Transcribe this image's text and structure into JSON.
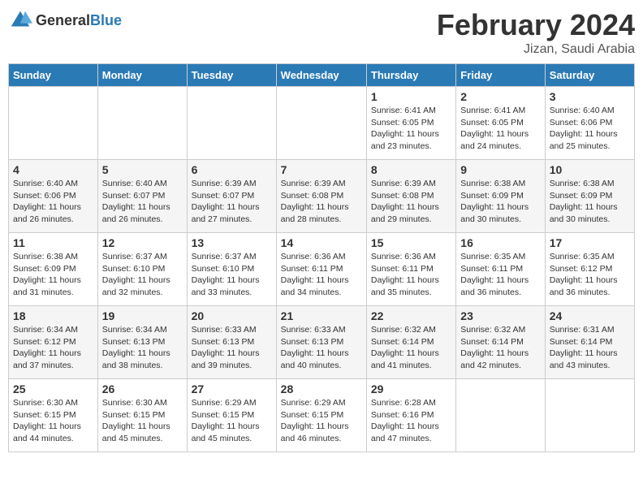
{
  "header": {
    "logo_general": "General",
    "logo_blue": "Blue",
    "month_title": "February 2024",
    "location": "Jizan, Saudi Arabia"
  },
  "weekdays": [
    "Sunday",
    "Monday",
    "Tuesday",
    "Wednesday",
    "Thursday",
    "Friday",
    "Saturday"
  ],
  "weeks": [
    [
      {
        "day": "",
        "info": ""
      },
      {
        "day": "",
        "info": ""
      },
      {
        "day": "",
        "info": ""
      },
      {
        "day": "",
        "info": ""
      },
      {
        "day": "1",
        "info": "Sunrise: 6:41 AM\nSunset: 6:05 PM\nDaylight: 11 hours\nand 23 minutes."
      },
      {
        "day": "2",
        "info": "Sunrise: 6:41 AM\nSunset: 6:05 PM\nDaylight: 11 hours\nand 24 minutes."
      },
      {
        "day": "3",
        "info": "Sunrise: 6:40 AM\nSunset: 6:06 PM\nDaylight: 11 hours\nand 25 minutes."
      }
    ],
    [
      {
        "day": "4",
        "info": "Sunrise: 6:40 AM\nSunset: 6:06 PM\nDaylight: 11 hours\nand 26 minutes."
      },
      {
        "day": "5",
        "info": "Sunrise: 6:40 AM\nSunset: 6:07 PM\nDaylight: 11 hours\nand 26 minutes."
      },
      {
        "day": "6",
        "info": "Sunrise: 6:39 AM\nSunset: 6:07 PM\nDaylight: 11 hours\nand 27 minutes."
      },
      {
        "day": "7",
        "info": "Sunrise: 6:39 AM\nSunset: 6:08 PM\nDaylight: 11 hours\nand 28 minutes."
      },
      {
        "day": "8",
        "info": "Sunrise: 6:39 AM\nSunset: 6:08 PM\nDaylight: 11 hours\nand 29 minutes."
      },
      {
        "day": "9",
        "info": "Sunrise: 6:38 AM\nSunset: 6:09 PM\nDaylight: 11 hours\nand 30 minutes."
      },
      {
        "day": "10",
        "info": "Sunrise: 6:38 AM\nSunset: 6:09 PM\nDaylight: 11 hours\nand 30 minutes."
      }
    ],
    [
      {
        "day": "11",
        "info": "Sunrise: 6:38 AM\nSunset: 6:09 PM\nDaylight: 11 hours\nand 31 minutes."
      },
      {
        "day": "12",
        "info": "Sunrise: 6:37 AM\nSunset: 6:10 PM\nDaylight: 11 hours\nand 32 minutes."
      },
      {
        "day": "13",
        "info": "Sunrise: 6:37 AM\nSunset: 6:10 PM\nDaylight: 11 hours\nand 33 minutes."
      },
      {
        "day": "14",
        "info": "Sunrise: 6:36 AM\nSunset: 6:11 PM\nDaylight: 11 hours\nand 34 minutes."
      },
      {
        "day": "15",
        "info": "Sunrise: 6:36 AM\nSunset: 6:11 PM\nDaylight: 11 hours\nand 35 minutes."
      },
      {
        "day": "16",
        "info": "Sunrise: 6:35 AM\nSunset: 6:11 PM\nDaylight: 11 hours\nand 36 minutes."
      },
      {
        "day": "17",
        "info": "Sunrise: 6:35 AM\nSunset: 6:12 PM\nDaylight: 11 hours\nand 36 minutes."
      }
    ],
    [
      {
        "day": "18",
        "info": "Sunrise: 6:34 AM\nSunset: 6:12 PM\nDaylight: 11 hours\nand 37 minutes."
      },
      {
        "day": "19",
        "info": "Sunrise: 6:34 AM\nSunset: 6:13 PM\nDaylight: 11 hours\nand 38 minutes."
      },
      {
        "day": "20",
        "info": "Sunrise: 6:33 AM\nSunset: 6:13 PM\nDaylight: 11 hours\nand 39 minutes."
      },
      {
        "day": "21",
        "info": "Sunrise: 6:33 AM\nSunset: 6:13 PM\nDaylight: 11 hours\nand 40 minutes."
      },
      {
        "day": "22",
        "info": "Sunrise: 6:32 AM\nSunset: 6:14 PM\nDaylight: 11 hours\nand 41 minutes."
      },
      {
        "day": "23",
        "info": "Sunrise: 6:32 AM\nSunset: 6:14 PM\nDaylight: 11 hours\nand 42 minutes."
      },
      {
        "day": "24",
        "info": "Sunrise: 6:31 AM\nSunset: 6:14 PM\nDaylight: 11 hours\nand 43 minutes."
      }
    ],
    [
      {
        "day": "25",
        "info": "Sunrise: 6:30 AM\nSunset: 6:15 PM\nDaylight: 11 hours\nand 44 minutes."
      },
      {
        "day": "26",
        "info": "Sunrise: 6:30 AM\nSunset: 6:15 PM\nDaylight: 11 hours\nand 45 minutes."
      },
      {
        "day": "27",
        "info": "Sunrise: 6:29 AM\nSunset: 6:15 PM\nDaylight: 11 hours\nand 45 minutes."
      },
      {
        "day": "28",
        "info": "Sunrise: 6:29 AM\nSunset: 6:15 PM\nDaylight: 11 hours\nand 46 minutes."
      },
      {
        "day": "29",
        "info": "Sunrise: 6:28 AM\nSunset: 6:16 PM\nDaylight: 11 hours\nand 47 minutes."
      },
      {
        "day": "",
        "info": ""
      },
      {
        "day": "",
        "info": ""
      }
    ]
  ]
}
